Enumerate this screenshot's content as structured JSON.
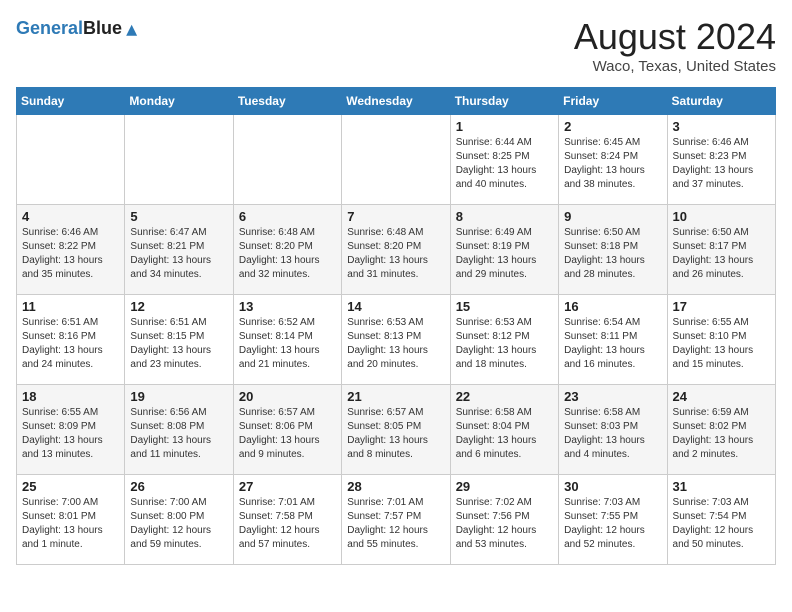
{
  "header": {
    "logo_line1": "General",
    "logo_line2": "Blue",
    "month_year": "August 2024",
    "location": "Waco, Texas, United States"
  },
  "days_of_week": [
    "Sunday",
    "Monday",
    "Tuesday",
    "Wednesday",
    "Thursday",
    "Friday",
    "Saturday"
  ],
  "weeks": [
    [
      {
        "day": "",
        "info": ""
      },
      {
        "day": "",
        "info": ""
      },
      {
        "day": "",
        "info": ""
      },
      {
        "day": "",
        "info": ""
      },
      {
        "day": "1",
        "info": "Sunrise: 6:44 AM\nSunset: 8:25 PM\nDaylight: 13 hours\nand 40 minutes."
      },
      {
        "day": "2",
        "info": "Sunrise: 6:45 AM\nSunset: 8:24 PM\nDaylight: 13 hours\nand 38 minutes."
      },
      {
        "day": "3",
        "info": "Sunrise: 6:46 AM\nSunset: 8:23 PM\nDaylight: 13 hours\nand 37 minutes."
      }
    ],
    [
      {
        "day": "4",
        "info": "Sunrise: 6:46 AM\nSunset: 8:22 PM\nDaylight: 13 hours\nand 35 minutes."
      },
      {
        "day": "5",
        "info": "Sunrise: 6:47 AM\nSunset: 8:21 PM\nDaylight: 13 hours\nand 34 minutes."
      },
      {
        "day": "6",
        "info": "Sunrise: 6:48 AM\nSunset: 8:20 PM\nDaylight: 13 hours\nand 32 minutes."
      },
      {
        "day": "7",
        "info": "Sunrise: 6:48 AM\nSunset: 8:20 PM\nDaylight: 13 hours\nand 31 minutes."
      },
      {
        "day": "8",
        "info": "Sunrise: 6:49 AM\nSunset: 8:19 PM\nDaylight: 13 hours\nand 29 minutes."
      },
      {
        "day": "9",
        "info": "Sunrise: 6:50 AM\nSunset: 8:18 PM\nDaylight: 13 hours\nand 28 minutes."
      },
      {
        "day": "10",
        "info": "Sunrise: 6:50 AM\nSunset: 8:17 PM\nDaylight: 13 hours\nand 26 minutes."
      }
    ],
    [
      {
        "day": "11",
        "info": "Sunrise: 6:51 AM\nSunset: 8:16 PM\nDaylight: 13 hours\nand 24 minutes."
      },
      {
        "day": "12",
        "info": "Sunrise: 6:51 AM\nSunset: 8:15 PM\nDaylight: 13 hours\nand 23 minutes."
      },
      {
        "day": "13",
        "info": "Sunrise: 6:52 AM\nSunset: 8:14 PM\nDaylight: 13 hours\nand 21 minutes."
      },
      {
        "day": "14",
        "info": "Sunrise: 6:53 AM\nSunset: 8:13 PM\nDaylight: 13 hours\nand 20 minutes."
      },
      {
        "day": "15",
        "info": "Sunrise: 6:53 AM\nSunset: 8:12 PM\nDaylight: 13 hours\nand 18 minutes."
      },
      {
        "day": "16",
        "info": "Sunrise: 6:54 AM\nSunset: 8:11 PM\nDaylight: 13 hours\nand 16 minutes."
      },
      {
        "day": "17",
        "info": "Sunrise: 6:55 AM\nSunset: 8:10 PM\nDaylight: 13 hours\nand 15 minutes."
      }
    ],
    [
      {
        "day": "18",
        "info": "Sunrise: 6:55 AM\nSunset: 8:09 PM\nDaylight: 13 hours\nand 13 minutes."
      },
      {
        "day": "19",
        "info": "Sunrise: 6:56 AM\nSunset: 8:08 PM\nDaylight: 13 hours\nand 11 minutes."
      },
      {
        "day": "20",
        "info": "Sunrise: 6:57 AM\nSunset: 8:06 PM\nDaylight: 13 hours\nand 9 minutes."
      },
      {
        "day": "21",
        "info": "Sunrise: 6:57 AM\nSunset: 8:05 PM\nDaylight: 13 hours\nand 8 minutes."
      },
      {
        "day": "22",
        "info": "Sunrise: 6:58 AM\nSunset: 8:04 PM\nDaylight: 13 hours\nand 6 minutes."
      },
      {
        "day": "23",
        "info": "Sunrise: 6:58 AM\nSunset: 8:03 PM\nDaylight: 13 hours\nand 4 minutes."
      },
      {
        "day": "24",
        "info": "Sunrise: 6:59 AM\nSunset: 8:02 PM\nDaylight: 13 hours\nand 2 minutes."
      }
    ],
    [
      {
        "day": "25",
        "info": "Sunrise: 7:00 AM\nSunset: 8:01 PM\nDaylight: 13 hours\nand 1 minute."
      },
      {
        "day": "26",
        "info": "Sunrise: 7:00 AM\nSunset: 8:00 PM\nDaylight: 12 hours\nand 59 minutes."
      },
      {
        "day": "27",
        "info": "Sunrise: 7:01 AM\nSunset: 7:58 PM\nDaylight: 12 hours\nand 57 minutes."
      },
      {
        "day": "28",
        "info": "Sunrise: 7:01 AM\nSunset: 7:57 PM\nDaylight: 12 hours\nand 55 minutes."
      },
      {
        "day": "29",
        "info": "Sunrise: 7:02 AM\nSunset: 7:56 PM\nDaylight: 12 hours\nand 53 minutes."
      },
      {
        "day": "30",
        "info": "Sunrise: 7:03 AM\nSunset: 7:55 PM\nDaylight: 12 hours\nand 52 minutes."
      },
      {
        "day": "31",
        "info": "Sunrise: 7:03 AM\nSunset: 7:54 PM\nDaylight: 12 hours\nand 50 minutes."
      }
    ]
  ]
}
